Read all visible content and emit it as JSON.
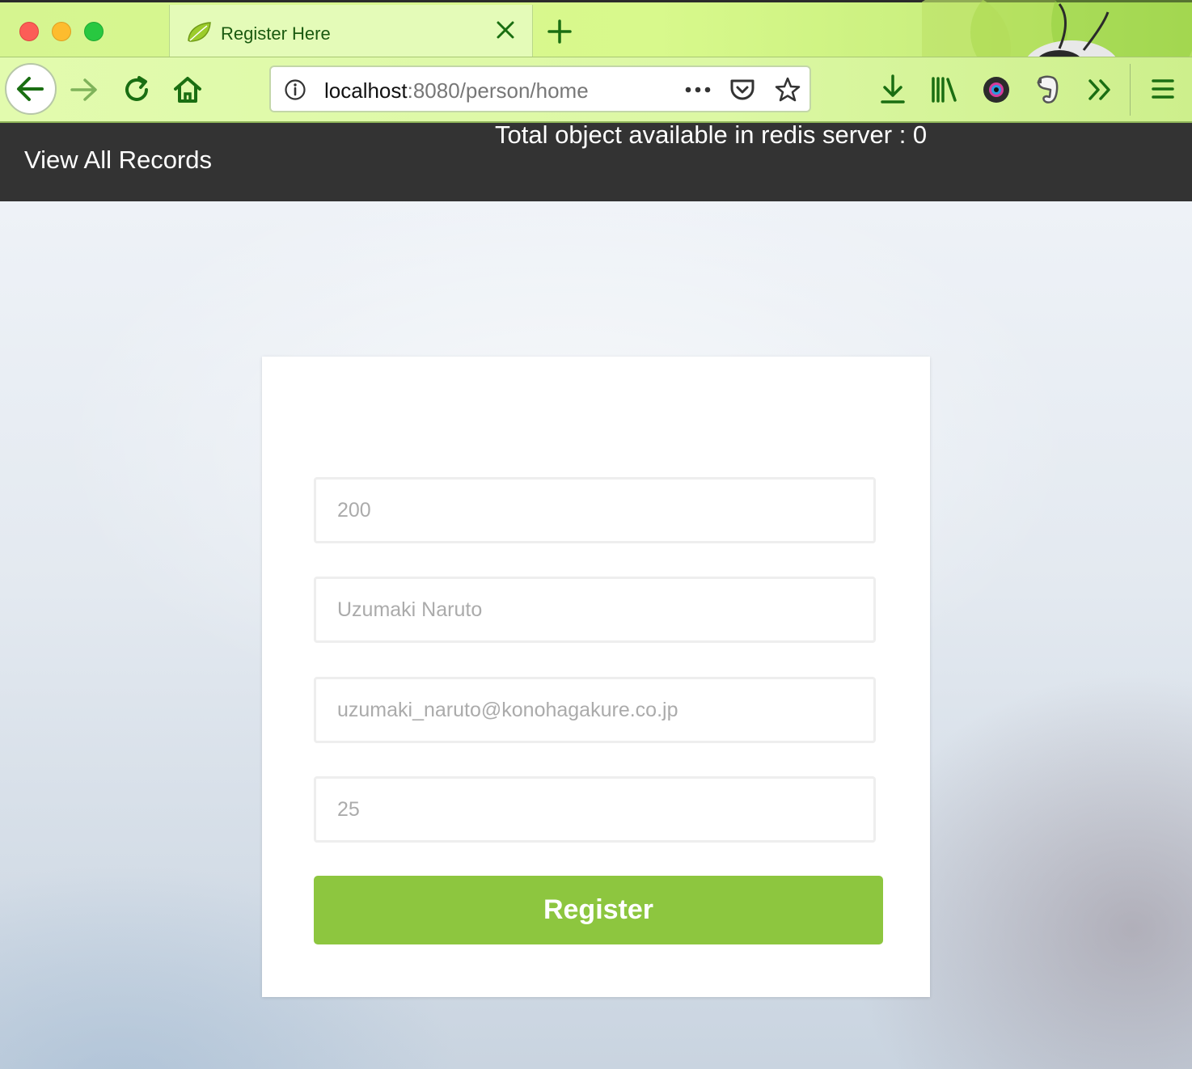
{
  "browser": {
    "tab": {
      "title": "Register Here"
    },
    "url": {
      "host": "localhost",
      "rest": ":8080/person/home"
    },
    "icons": [
      "back-icon",
      "forward-icon",
      "reload-icon",
      "home-icon",
      "info-icon",
      "more-icon",
      "pocket-icon",
      "bookmark-star-icon",
      "download-icon",
      "library-icon",
      "camera-extension-icon",
      "evernote-icon",
      "overflow-chevron-icon",
      "menu-icon"
    ],
    "theme_color": "#d6f590"
  },
  "header": {
    "view_all_label": "View All Records",
    "redis_label": "Total object available in redis server : 0"
  },
  "form": {
    "id_placeholder": "200",
    "name_placeholder": "Uzumaki Naruto",
    "email_placeholder": "uzumaki_naruto@konohagakure.co.jp",
    "age_placeholder": "25",
    "register_label": "Register",
    "button_color": "#8dc63f"
  }
}
